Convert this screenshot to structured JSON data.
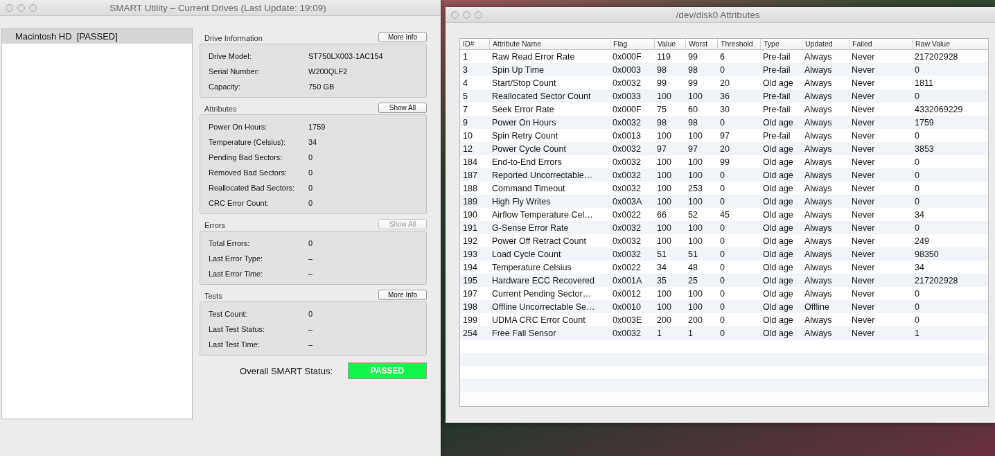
{
  "main_window": {
    "title": "SMART Utility – Current Drives (Last Update: 19:09)",
    "drive_list": [
      {
        "label": "Macintosh HD  [PASSED]",
        "selected": true
      }
    ],
    "sections": [
      {
        "title": "Drive Information",
        "button": {
          "label": "More Info",
          "disabled": false
        },
        "rows": [
          {
            "label": "Drive Model:",
            "value": "ST750LX003-1AC154"
          },
          {
            "label": "Serial Number:",
            "value": "W200QLF2"
          },
          {
            "label": "Capacity:",
            "value": "750 GB"
          }
        ]
      },
      {
        "title": "Attributes",
        "button": {
          "label": "Show All",
          "disabled": false
        },
        "rows": [
          {
            "label": "Power On Hours:",
            "value": "1759"
          },
          {
            "label": "Temperature (Celsius):",
            "value": "34"
          },
          {
            "label": "Pending Bad Sectors:",
            "value": "0"
          },
          {
            "label": "Removed Bad Sectors:",
            "value": "0"
          },
          {
            "label": "Reallocated Bad Sectors:",
            "value": "0"
          },
          {
            "label": "CRC Error Count:",
            "value": "0"
          }
        ]
      },
      {
        "title": "Errors",
        "button": {
          "label": "Show All",
          "disabled": true
        },
        "rows": [
          {
            "label": "Total Errors:",
            "value": "0"
          },
          {
            "label": "Last Error Type:",
            "value": "–"
          },
          {
            "label": "Last Error Time:",
            "value": "–"
          }
        ]
      },
      {
        "title": "Tests",
        "button": {
          "label": "More Info",
          "disabled": false
        },
        "rows": [
          {
            "label": "Test Count:",
            "value": "0"
          },
          {
            "label": "Last Test Status:",
            "value": "–"
          },
          {
            "label": "Last Test Time:",
            "value": "–"
          }
        ]
      }
    ],
    "overall_status": {
      "label": "Overall SMART Status:",
      "value": "PASSED"
    }
  },
  "attributes_window": {
    "title": "/dev/disk0 Attributes",
    "columns": [
      "ID#",
      "Attribute Name",
      "Flag",
      "Value",
      "Worst",
      "Threshold",
      "Type",
      "Updated",
      "Failed",
      "Raw Value"
    ],
    "rows": [
      [
        "1",
        "Raw Read Error Rate",
        "0x000F",
        "119",
        "99",
        "6",
        "Pre-fail",
        "Always",
        "Never",
        "217202928"
      ],
      [
        "3",
        "Spin Up Time",
        "0x0003",
        "98",
        "98",
        "0",
        "Pre-fail",
        "Always",
        "Never",
        "0"
      ],
      [
        "4",
        "Start/Stop Count",
        "0x0032",
        "99",
        "99",
        "20",
        "Old age",
        "Always",
        "Never",
        "1811"
      ],
      [
        "5",
        "Reallocated Sector Count",
        "0x0033",
        "100",
        "100",
        "36",
        "Pre-fail",
        "Always",
        "Never",
        "0"
      ],
      [
        "7",
        "Seek Error Rate",
        "0x000F",
        "75",
        "60",
        "30",
        "Pre-fail",
        "Always",
        "Never",
        "4332069229"
      ],
      [
        "9",
        "Power On Hours",
        "0x0032",
        "98",
        "98",
        "0",
        "Old age",
        "Always",
        "Never",
        "1759"
      ],
      [
        "10",
        "Spin Retry Count",
        "0x0013",
        "100",
        "100",
        "97",
        "Pre-fail",
        "Always",
        "Never",
        "0"
      ],
      [
        "12",
        "Power Cycle Count",
        "0x0032",
        "97",
        "97",
        "20",
        "Old age",
        "Always",
        "Never",
        "3853"
      ],
      [
        "184",
        "End-to-End Errors",
        "0x0032",
        "100",
        "100",
        "99",
        "Old age",
        "Always",
        "Never",
        "0"
      ],
      [
        "187",
        "Reported Uncorrectable…",
        "0x0032",
        "100",
        "100",
        "0",
        "Old age",
        "Always",
        "Never",
        "0"
      ],
      [
        "188",
        "Command Timeout",
        "0x0032",
        "100",
        "253",
        "0",
        "Old age",
        "Always",
        "Never",
        "0"
      ],
      [
        "189",
        "High Fly Writes",
        "0x003A",
        "100",
        "100",
        "0",
        "Old age",
        "Always",
        "Never",
        "0"
      ],
      [
        "190",
        "Airflow Temperature Cel…",
        "0x0022",
        "66",
        "52",
        "45",
        "Old age",
        "Always",
        "Never",
        "34"
      ],
      [
        "191",
        "G-Sense Error Rate",
        "0x0032",
        "100",
        "100",
        "0",
        "Old age",
        "Always",
        "Never",
        "0"
      ],
      [
        "192",
        "Power Off Retract Count",
        "0x0032",
        "100",
        "100",
        "0",
        "Old age",
        "Always",
        "Never",
        "249"
      ],
      [
        "193",
        "Load Cycle Count",
        "0x0032",
        "51",
        "51",
        "0",
        "Old age",
        "Always",
        "Never",
        "98350"
      ],
      [
        "194",
        "Temperature Celsius",
        "0x0022",
        "34",
        "48",
        "0",
        "Old age",
        "Always",
        "Never",
        "34"
      ],
      [
        "195",
        "Hardware ECC Recovered",
        "0x001A",
        "35",
        "25",
        "0",
        "Old age",
        "Always",
        "Never",
        "217202928"
      ],
      [
        "197",
        "Current Pending Sector…",
        "0x0012",
        "100",
        "100",
        "0",
        "Old age",
        "Always",
        "Never",
        "0"
      ],
      [
        "198",
        "Offline Uncorrectable Se…",
        "0x0010",
        "100",
        "100",
        "0",
        "Old age",
        "Offline",
        "Never",
        "0"
      ],
      [
        "199",
        "UDMA CRC Error Count",
        "0x003E",
        "200",
        "200",
        "0",
        "Old age",
        "Always",
        "Never",
        "0"
      ],
      [
        "254",
        "Free Fall Sensor",
        "0x0032",
        "1",
        "1",
        "0",
        "Old age",
        "Always",
        "Never",
        "1"
      ]
    ]
  }
}
